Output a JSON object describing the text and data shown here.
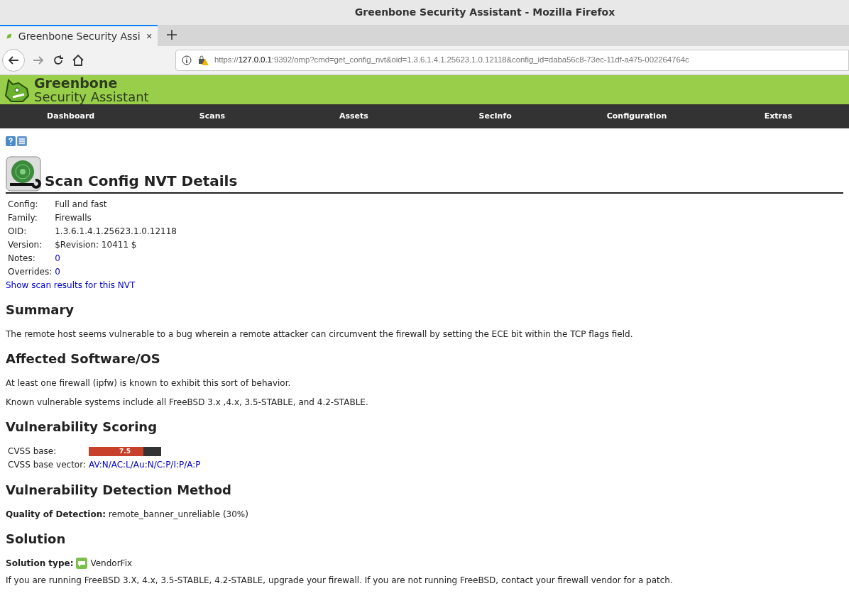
{
  "window": {
    "title": "Greenbone Security Assistant - Mozilla Firefox"
  },
  "tabs": [
    {
      "title": "Greenbone Security Assi",
      "selected": true
    }
  ],
  "address_bar": {
    "url_scheme": "https://",
    "url_host": "127.0.0.1",
    "url_rest": ":9392/omp?cmd=get_config_nvt&oid=1.3.6.1.4.1.25623.1.0.12118&config_id=daba56c8-73ec-11df-a475-002264764c"
  },
  "app_header": {
    "brand_line_1": "Greenbone",
    "brand_line_2": "Security Assistant"
  },
  "main_menu": [
    "Dashboard",
    "Scans",
    "Assets",
    "SecInfo",
    "Configuration",
    "Extras"
  ],
  "page": {
    "title": "Scan Config NVT Details",
    "details": [
      {
        "label": "Config:",
        "value": "Full and fast",
        "kind": "text"
      },
      {
        "label": "Family:",
        "value": "Firewalls",
        "kind": "text"
      },
      {
        "label": "OID:",
        "value": "1.3.6.1.4.1.25623.1.0.12118",
        "kind": "text"
      },
      {
        "label": "Version:",
        "value": "$Revision: 10411 $",
        "kind": "text"
      },
      {
        "label": "Notes:",
        "value": "0",
        "kind": "link"
      },
      {
        "label": "Overrides:",
        "value": "0",
        "kind": "link"
      }
    ],
    "results_link": "Show scan results for this NVT",
    "sections": [
      {
        "heading": "Summary",
        "paragraphs": [
          "The remote host seems vulnerable to a bug wherein a remote attacker can circumvent the firewall by setting the ECE bit within the TCP flags field."
        ]
      },
      {
        "heading": "Affected Software/OS",
        "paragraphs": [
          "At least one firewall (ipfw) is known to exhibit this sort of behavior.",
          "Known vulnerable systems include all FreeBSD 3.x ,4.x, 3.5-STABLE, and 4.2-STABLE."
        ]
      },
      {
        "heading": "Vulnerability Scoring",
        "scoring": {
          "base_label": "CVSS base:",
          "score": "7.5",
          "level": 0.75,
          "vector_label": "CVSS base vector:",
          "vector": "AV:N/AC:L/Au:N/C:P/I:P/A:P"
        }
      },
      {
        "heading": "Vulnerability Detection Method",
        "paragraphs": [
          "**Quality of Detection:** remote_banner_unreliable (30%)"
        ]
      },
      {
        "heading": "Solution",
        "solution_type": {
          "label": "Solution type:",
          "value": "VendorFix"
        },
        "paragraphs": [
          "If you are running FreeBSD 3.X, 4.x, 3.5-STABLE, 4.2-STABLE, upgrade your firewall. If you are not running FreeBSD, contact your firewall vendor for a patch."
        ]
      }
    ]
  }
}
